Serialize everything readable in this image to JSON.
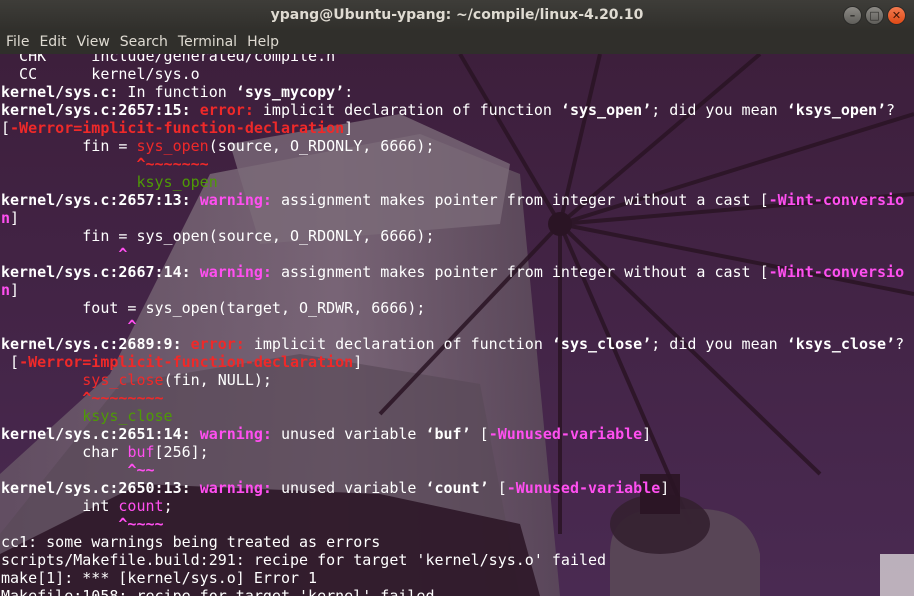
{
  "window": {
    "title": "ypang@Ubuntu-ypang: ~/compile/linux-4.20.10",
    "buttons": {
      "minimize": "–",
      "maximize": "□",
      "close": "✕"
    }
  },
  "menu": [
    "File",
    "Edit",
    "View",
    "Search",
    "Terminal",
    "Help"
  ],
  "terminal": {
    "colors": {
      "background": "#3c1f3a",
      "text": "#ffffff",
      "error": "#ef2929",
      "warning": "#ff4ff0",
      "hint": "#4e9a06"
    },
    "lines": [
      {
        "text": "  CHK     include/generated/compile.h"
      },
      {
        "text": "  CC      kernel/sys.o"
      },
      {
        "a": "kernel/sys.c:",
        "b": " In function ",
        "c": "‘sys_mycopy’",
        "d": ":"
      },
      {
        "a": "kernel/sys.c:2657:15: ",
        "b": "error:",
        "c": " implicit declaration of function ",
        "d": "‘sys_open’",
        "e": "; did you mean ",
        "f": "‘ksys_open’",
        "g": "?"
      },
      {
        "a": "[",
        "b": "-Werror=implicit-function-declaration",
        "c": "]"
      },
      {
        "a": "         fin = ",
        "b": "sys_open",
        "c": "(source, O_RDONLY, 6666);"
      },
      {
        "a": "               ",
        "b": "^~~~~~~~"
      },
      {
        "a": "               ",
        "b": "ksys_open"
      },
      {
        "a": "kernel/sys.c:2657:13: ",
        "b": "warning:",
        "c": " assignment makes pointer from integer without a cast [",
        "d": "-Wint-conversio"
      },
      {
        "a": "n",
        "b": "]"
      },
      {
        "a": "         fin = sys_open(source, O_RDONLY, 6666);"
      },
      {
        "a": "             ",
        "b": "^"
      },
      {
        "a": "kernel/sys.c:2667:14: ",
        "b": "warning:",
        "c": " assignment makes pointer from integer without a cast [",
        "d": "-Wint-conversio"
      },
      {
        "a": "n",
        "b": "]"
      },
      {
        "a": "         fout = sys_open(target, O_RDWR, 6666);"
      },
      {
        "a": "              ",
        "b": "^"
      },
      {
        "a": "kernel/sys.c:2689:9: ",
        "b": "error:",
        "c": " implicit declaration of function ",
        "d": "‘sys_close’",
        "e": "; did you mean ",
        "f": "‘ksys_close’",
        "g": "?"
      },
      {
        "a": " [",
        "b": "-Werror=implicit-function-declaration",
        "c": "]"
      },
      {
        "a": "         ",
        "b": "sys_close",
        "c": "(fin, NULL);"
      },
      {
        "a": "         ",
        "b": "^~~~~~~~~"
      },
      {
        "a": "         ",
        "b": "ksys_close"
      },
      {
        "a": "kernel/sys.c:2651:14: ",
        "b": "warning:",
        "c": " unused variable ",
        "d": "‘buf’",
        "e": " [",
        "f": "-Wunused-variable",
        "g": "]"
      },
      {
        "a": "         char ",
        "b": "buf",
        "c": "[256];"
      },
      {
        "a": "              ",
        "b": "^~~"
      },
      {
        "a": "kernel/sys.c:2650:13: ",
        "b": "warning:",
        "c": " unused variable ",
        "d": "‘count’",
        "e": " [",
        "f": "-Wunused-variable",
        "g": "]"
      },
      {
        "a": "         int ",
        "b": "count",
        "c": ";"
      },
      {
        "a": "             ",
        "b": "^~~~~"
      },
      {
        "text": "cc1: some warnings being treated as errors"
      },
      {
        "text": "scripts/Makefile.build:291: recipe for target 'kernel/sys.o' failed"
      },
      {
        "text": "make[1]: *** [kernel/sys.o] Error 1"
      },
      {
        "text": "Makefile:1058: recipe for target 'kernel' failed"
      }
    ]
  }
}
